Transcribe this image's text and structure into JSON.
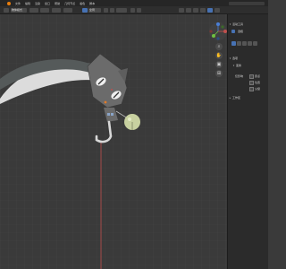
{
  "menubar": {
    "items": [
      "文件",
      "编辑",
      "渲染",
      "窗口",
      "帮助",
      "几何节点",
      "着色",
      "脚本"
    ]
  },
  "toolbar": {
    "mode": "物体模式",
    "transform": "全局",
    "snap": "选择"
  },
  "properties": {
    "active_tool_header": "活动工具",
    "select_label": "选框",
    "options_header": "选项",
    "transform_header": "变换",
    "affect_only_label": "仅影响",
    "origins_label": "原点",
    "locations_label": "位置",
    "parents_label": "父级",
    "workspace_header": "工作区"
  },
  "colors": {
    "viewport_bg": "#3a3a3a",
    "grid": "#434343",
    "accent": "#4772b3",
    "axis_red": "#c0504d",
    "axis_green": "#6fbf40",
    "axis_blue": "#4a7fd6",
    "blade": "#dcdcdc",
    "cat_body": "#6b6b6b",
    "bell": "#c8d1a0"
  },
  "icons": {
    "zoom": "magnifier-icon",
    "pan": "hand-icon",
    "camera": "camera-icon",
    "persp": "grid-icon"
  }
}
